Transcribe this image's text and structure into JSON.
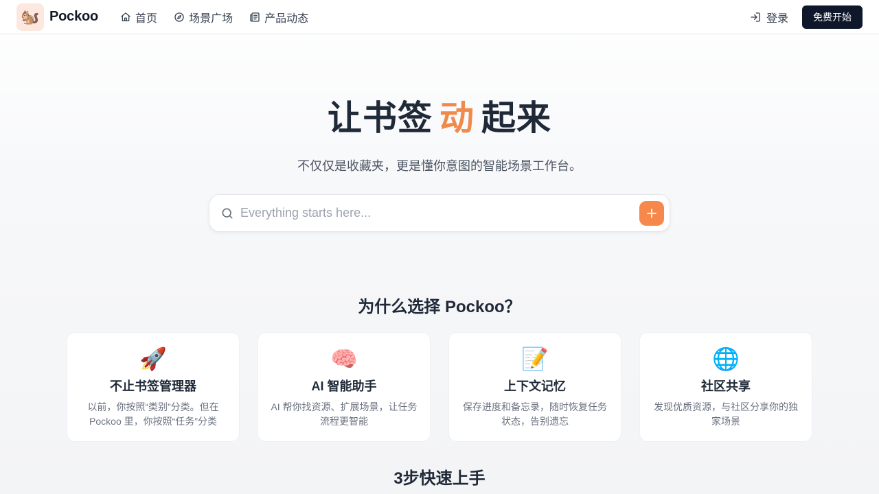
{
  "header": {
    "brand": "Pockoo",
    "logo_emoji": "🐿️",
    "nav": [
      {
        "label": "首页",
        "icon": "home-icon"
      },
      {
        "label": "场景广场",
        "icon": "compass-icon"
      },
      {
        "label": "产品动态",
        "icon": "newspaper-icon"
      }
    ],
    "login_label": "登录",
    "cta_label": "免费开始"
  },
  "hero": {
    "title_before": "让书签",
    "title_accent": "动",
    "title_after": "起来",
    "subtitle": "不仅仅是收藏夹，更是懂你意图的智能场景工作台。",
    "search_placeholder": "Everything starts here..."
  },
  "why": {
    "title": "为什么选择 Pockoo？",
    "cards": [
      {
        "emoji": "🚀",
        "title": "不止书签管理器",
        "desc": "以前，你按照“类别”分类。但在 Pockoo 里，你按照“任务”分类"
      },
      {
        "emoji": "🧠",
        "title": "AI 智能助手",
        "desc": "AI 帮你找资源、扩展场景，让任务流程更智能"
      },
      {
        "emoji": "📝",
        "title": "上下文记忆",
        "desc": "保存进度和备忘录，随时恢复任务状态，告别遗忘"
      },
      {
        "emoji": "🌐",
        "title": "社区共享",
        "desc": "发现优质资源，与社区分享你的独家场景"
      }
    ]
  },
  "steps": {
    "title": "3步快速上手"
  },
  "colors": {
    "accent": "#f08a4b",
    "cta_bg": "#0f172a",
    "add_button": "#f5884a"
  }
}
